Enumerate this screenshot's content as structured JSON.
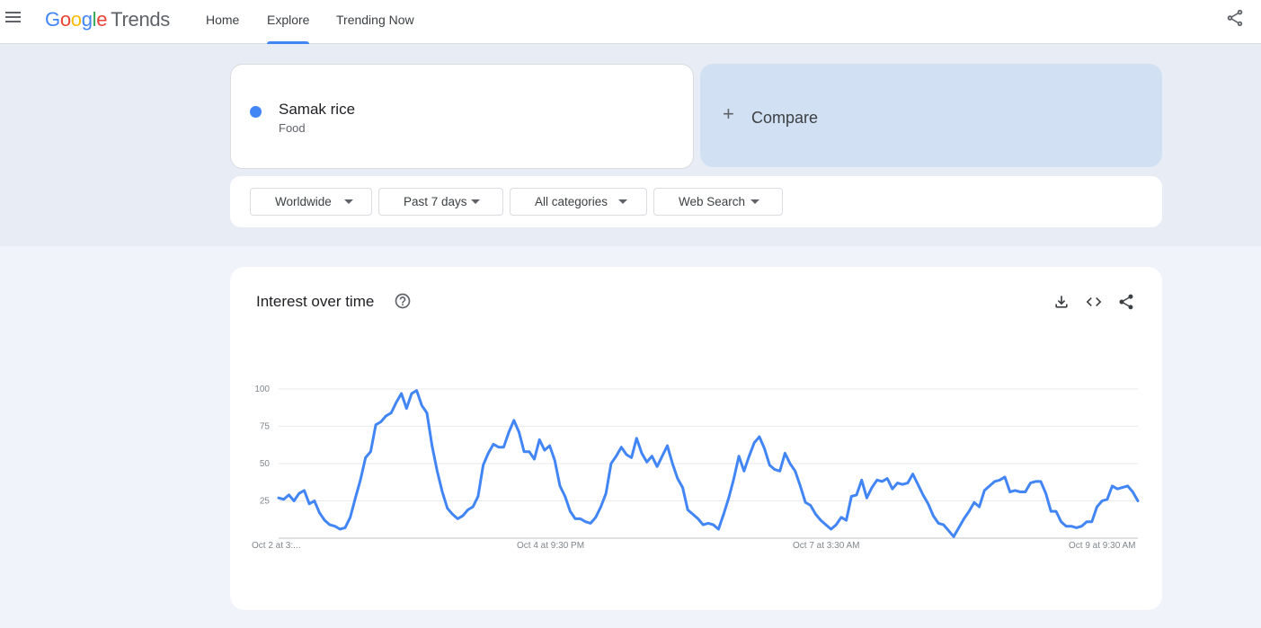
{
  "header": {
    "logo": [
      "G",
      "o",
      "o",
      "g",
      "l",
      "e"
    ],
    "logo_suffix": "Trends",
    "nav": [
      "Home",
      "Explore",
      "Trending Now"
    ]
  },
  "term": {
    "name": "Samak rice",
    "category": "Food",
    "color": "#4285f4"
  },
  "compare": {
    "plus": "+",
    "label": "Compare"
  },
  "filters": [
    "Worldwide",
    "Past 7 days",
    "All categories",
    "Web Search"
  ],
  "card": {
    "title": "Interest over time"
  },
  "icons": [
    "menu-icon",
    "share-icon",
    "help-icon",
    "download-icon",
    "embed-icon",
    "share-icon"
  ],
  "chart_data": {
    "type": "line",
    "x_tick_labels": [
      "Oct 2 at 3:...",
      "Oct 4 at 9:30 PM",
      "Oct 7 at 3:30 AM",
      "Oct 9 at 9:30 AM"
    ],
    "yticks": [
      25,
      50,
      75,
      100
    ],
    "ylim": [
      0,
      100
    ],
    "grid": true,
    "series": [
      {
        "color": "#4285f4",
        "values": [
          27,
          26,
          29,
          25,
          30,
          32,
          23,
          25,
          17,
          12,
          9,
          8,
          6,
          7,
          14,
          27,
          39,
          54,
          58,
          76,
          78,
          82,
          84,
          91,
          97,
          87,
          97,
          99,
          89,
          84,
          62,
          45,
          31,
          20,
          16,
          13,
          15,
          19,
          21,
          28,
          49,
          57,
          63,
          61,
          61,
          71,
          79,
          71,
          58,
          58,
          53,
          66,
          59,
          62,
          52,
          35,
          28,
          18,
          13,
          13,
          11,
          10,
          14,
          21,
          30,
          50,
          55,
          61,
          56,
          54,
          67,
          57,
          51,
          55,
          48,
          55,
          62,
          50,
          40,
          34,
          19,
          16,
          13,
          9,
          10,
          9,
          6,
          16,
          27,
          40,
          55,
          45,
          55,
          64,
          68,
          60,
          49,
          46,
          45,
          57,
          50,
          45,
          35,
          24,
          22,
          16,
          12,
          9,
          6,
          9,
          14,
          12,
          28,
          29,
          39,
          27,
          34,
          39,
          38,
          40,
          33,
          37,
          36,
          37,
          43,
          36,
          29,
          23,
          15,
          10,
          9,
          5,
          1,
          7,
          13,
          18,
          24,
          21,
          32,
          35,
          38,
          39,
          41,
          31,
          32,
          31,
          31,
          37,
          38,
          38,
          30,
          18,
          18,
          11,
          8,
          8,
          7,
          8,
          11,
          11,
          21,
          25,
          26,
          35,
          33,
          34,
          35,
          31,
          25
        ]
      }
    ]
  }
}
